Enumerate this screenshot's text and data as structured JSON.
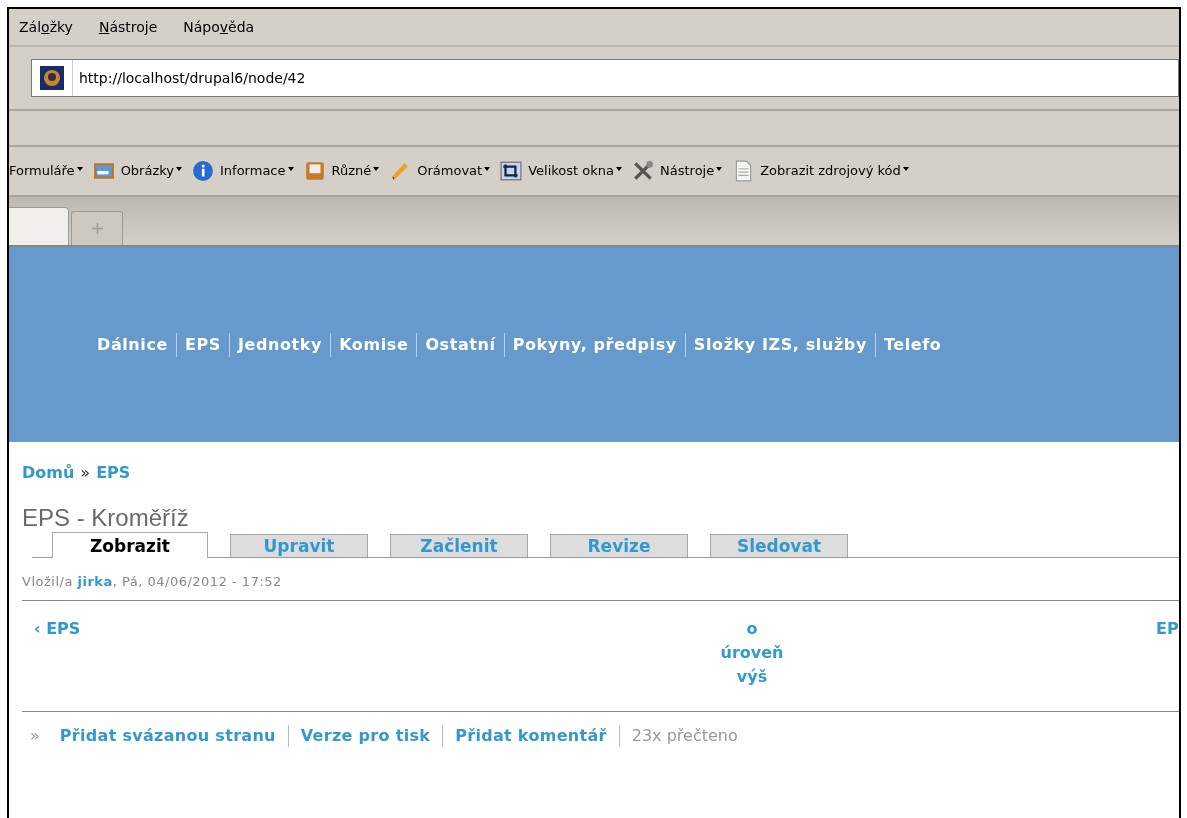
{
  "menu": [
    {
      "before": "Zál",
      "key": "o",
      "after": "žky"
    },
    {
      "key": "N",
      "after": "ástroje"
    },
    {
      "before": "Nápo",
      "key": "v",
      "after": "ěda"
    }
  ],
  "address": {
    "value": "http://localhost/drupal6/node/42"
  },
  "toolbar": [
    {
      "label": "Formuláře"
    },
    {
      "label": "Obrázky"
    },
    {
      "label": "Informace"
    },
    {
      "label": "Různé"
    },
    {
      "label": "Orámovat"
    },
    {
      "label": "Velikost okna"
    },
    {
      "label": "Nástroje"
    },
    {
      "label": "Zobrazit zdrojový kód"
    }
  ],
  "browser_tabs": [
    {
      "kind": "page",
      "selected": true
    },
    {
      "kind": "new",
      "selected": false
    }
  ],
  "nav": [
    "Dálnice",
    "EPS",
    "Jednotky",
    "Komise",
    "Ostatní",
    "Pokyny, předpisy",
    "Složky IZS, služby",
    "Telefo"
  ],
  "breadcrumb": {
    "items": [
      "Domů",
      "EPS"
    ],
    "separator": "»"
  },
  "title": "EPS - Kroměříž",
  "tabs": [
    {
      "label": "Zobrazit",
      "selected": true
    },
    {
      "label": "Upravit",
      "selected": false
    },
    {
      "label": "Začlenit",
      "selected": false
    },
    {
      "label": "Revize",
      "selected": false
    },
    {
      "label": "Sledovat",
      "selected": false
    }
  ],
  "meta": {
    "prefix": "Vložil/a ",
    "author": "jirka",
    "suffix": ", Pá, 04/06/2012 - 17:52"
  },
  "pager": {
    "previous": "‹ EPS",
    "up": "o úroveň výš",
    "next": "EP"
  },
  "links": {
    "bullet": "»",
    "items": [
      {
        "kind": "link",
        "label": "Přidat svázanou stranu"
      },
      {
        "kind": "link",
        "label": "Verze pro tisk"
      },
      {
        "kind": "link",
        "label": "Přidat komentář"
      },
      {
        "kind": "text",
        "label": "23x přečteno"
      }
    ]
  }
}
